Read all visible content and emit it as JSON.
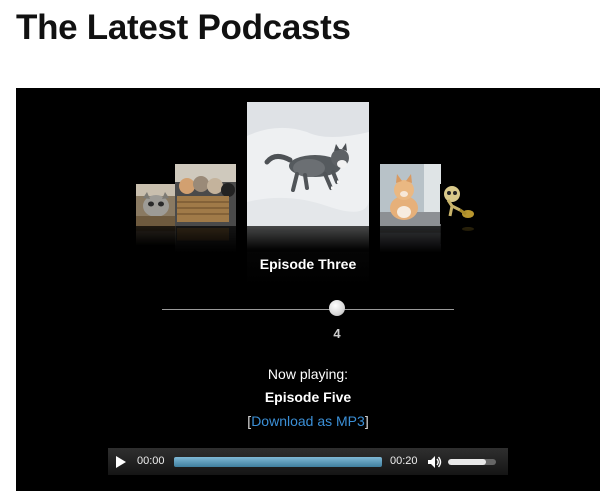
{
  "page": {
    "title": "The Latest Podcasts"
  },
  "carousel": {
    "covers": [
      {
        "name": "kitten-in-basket"
      },
      {
        "name": "kittens-in-basket"
      },
      {
        "name": "cat-in-snow"
      },
      {
        "name": "orange-cat"
      },
      {
        "name": "skull-figurine"
      }
    ],
    "current_title": "Episode Three",
    "position": "4"
  },
  "now_playing": {
    "label": "Now playing:",
    "title": "Episode Five",
    "bracket_open": "[",
    "download_label": "Download as MP3",
    "bracket_close": "]"
  },
  "audio": {
    "current_time": "00:00",
    "duration": "00:20",
    "volume": 0.8,
    "icons": {
      "play": "play-icon",
      "volume": "volume-icon"
    }
  },
  "colors": {
    "player_bg": "#000000",
    "link": "#3b8fd6",
    "progress": "#4a8bb0"
  }
}
